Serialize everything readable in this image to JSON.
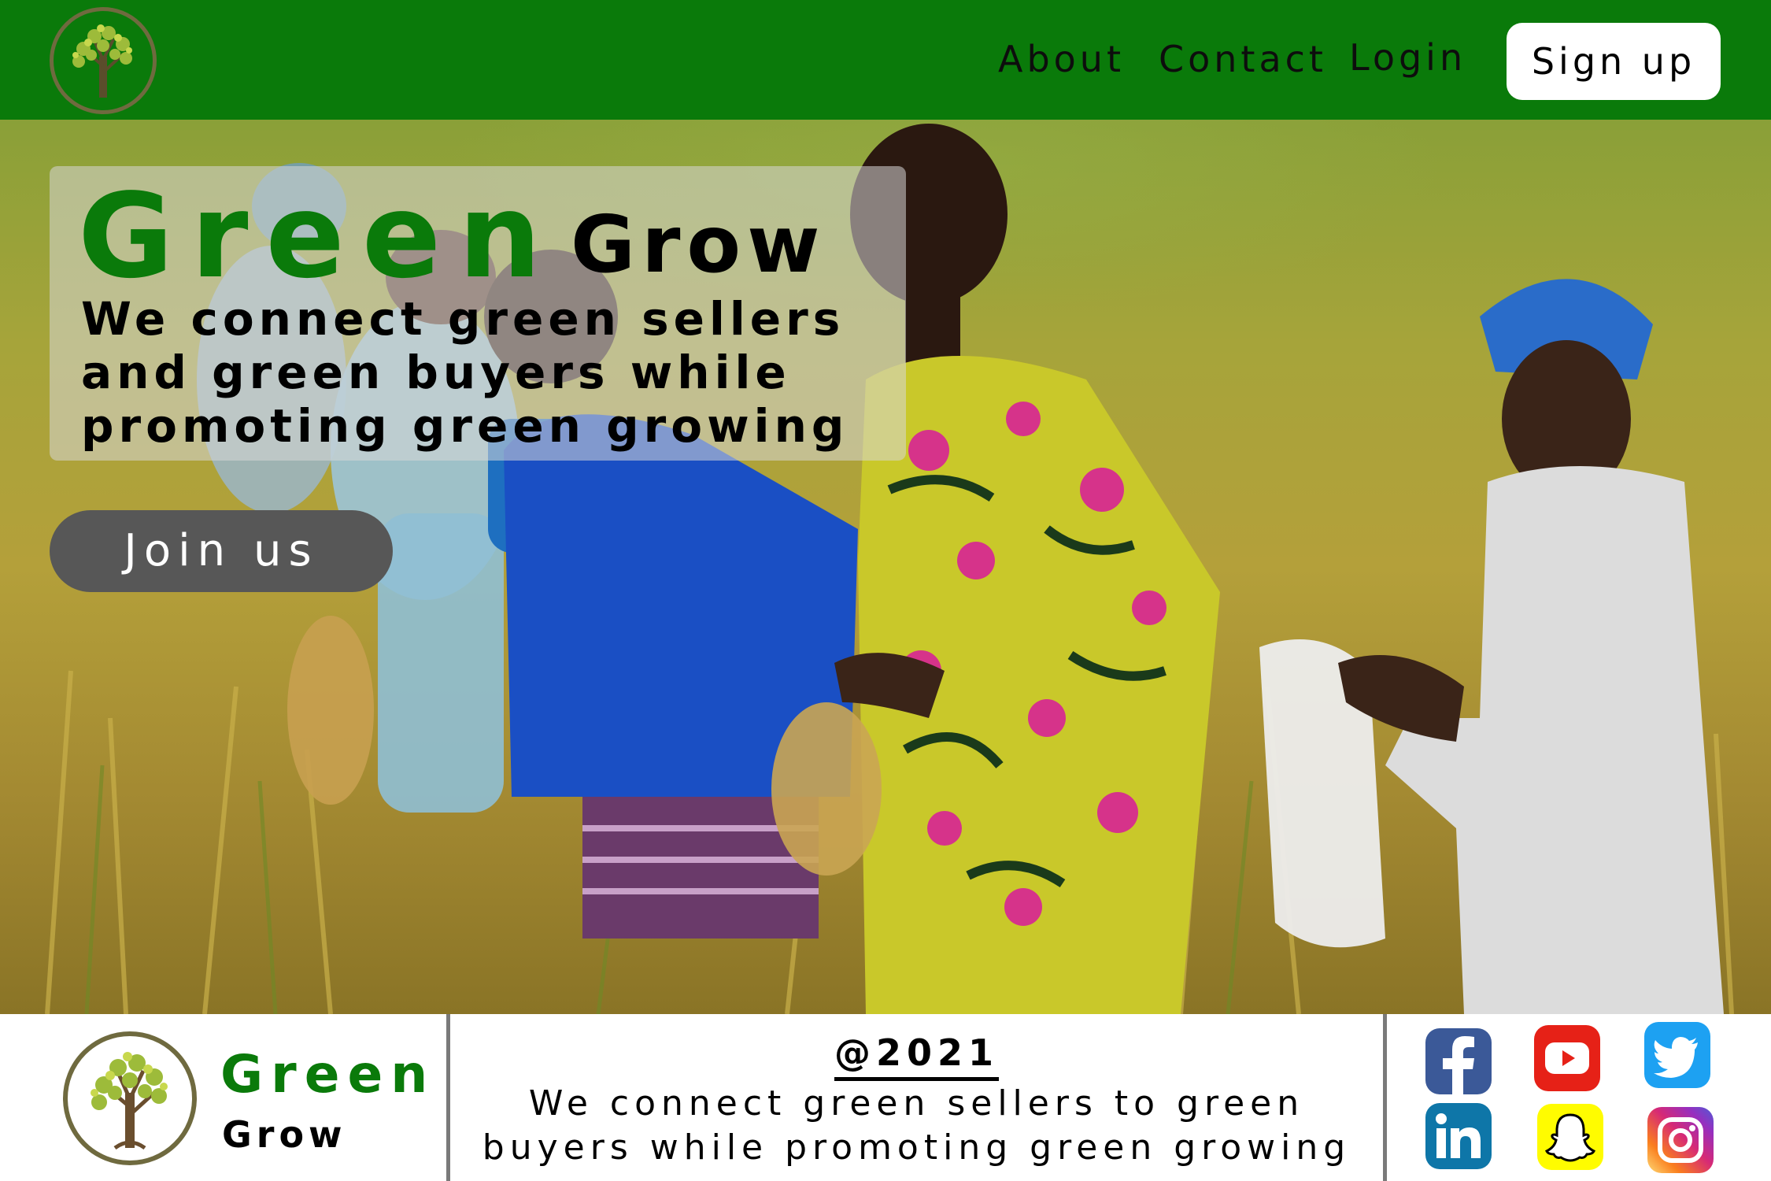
{
  "nav": {
    "logo_icon": "tree-icon",
    "links": [
      "About",
      "Contact",
      "Login"
    ],
    "signup_label": "Sign up"
  },
  "hero": {
    "title_part1": "Green",
    "title_part2": "Grow",
    "tagline": "We connect green sellers and green buyers while promoting green growing",
    "cta_label": "Join us",
    "image": "farmers-harvesting-rice-photo"
  },
  "footer": {
    "logo_icon": "tree-icon",
    "brand_part1": "Green",
    "brand_part2": "Grow",
    "year": "@2021",
    "tagline": "We connect green sellers to green buyers while promoting green growing",
    "social": [
      {
        "name": "facebook",
        "icon": "facebook-icon",
        "color": "#3b5998"
      },
      {
        "name": "youtube",
        "icon": "youtube-icon",
        "color": "#e62117"
      },
      {
        "name": "twitter",
        "icon": "twitter-icon",
        "color": "#1da1f2"
      },
      {
        "name": "linkedin",
        "icon": "linkedin-icon",
        "color": "#0e76a8"
      },
      {
        "name": "snapchat",
        "icon": "snapchat-icon",
        "color": "#fffc00"
      },
      {
        "name": "instagram",
        "icon": "instagram-icon",
        "color": "#d62976"
      }
    ]
  },
  "colors": {
    "brand_green": "#0a7a0a",
    "button_gray": "#575757",
    "card_overlay": "rgba(215,215,215,0.55)"
  }
}
